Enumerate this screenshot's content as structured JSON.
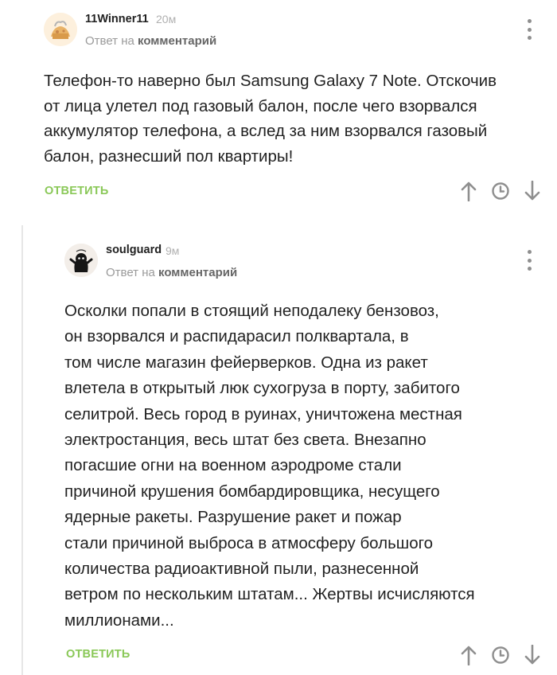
{
  "comments": [
    {
      "author": "11Winner11",
      "time": "20м",
      "reply_prefix": "Ответ на",
      "reply_link": "комментарий",
      "text": "Телефон-то наверно был Samsung Galaxy 7 Note. Отскочив\nот лица улетел под газовый балон, после чего взорвался\nаккумулятор телефона, а вслед за ним взорвался газовый\nбалон, разнесший пол квартиры!",
      "reply_label": "ответить"
    },
    {
      "author": "soulguard",
      "time": "9м",
      "reply_prefix": "Ответ на",
      "reply_link": "комментарий",
      "text": "Осколки попали в стоящий неподалеку бензовоз,\nон взорвался и распидарасил полквартала, в\nтом числе магазин фейерверков. Одна из ракет\nвлетела в открытый люк сухогруза в порту, забитого\nселитрой. Весь город в руинах, уничтожена местная\nэлектростанция, весь штат без света. Внезапно\nпогасшие огни на военном аэродроме стали\nпричиной крушения бомбардировщика, несущего\nядерные ракеты. Разрушение ракет и пожар\nстали причиной выброса в атмосферу большого\nколичества радиоактивной пыли, разнесенной\nветром по нескольким штатам... Жертвы исчисляются\nмиллионами...",
      "reply_label": "ответить"
    }
  ],
  "icons": {
    "more": "more-vertical-icon",
    "upvote": "arrow-up-icon",
    "save": "clock-icon",
    "downvote": "arrow-down-icon"
  },
  "colors": {
    "accent": "#8ac858",
    "icon": "#8f8f8f",
    "muted": "#9a9a9a"
  }
}
